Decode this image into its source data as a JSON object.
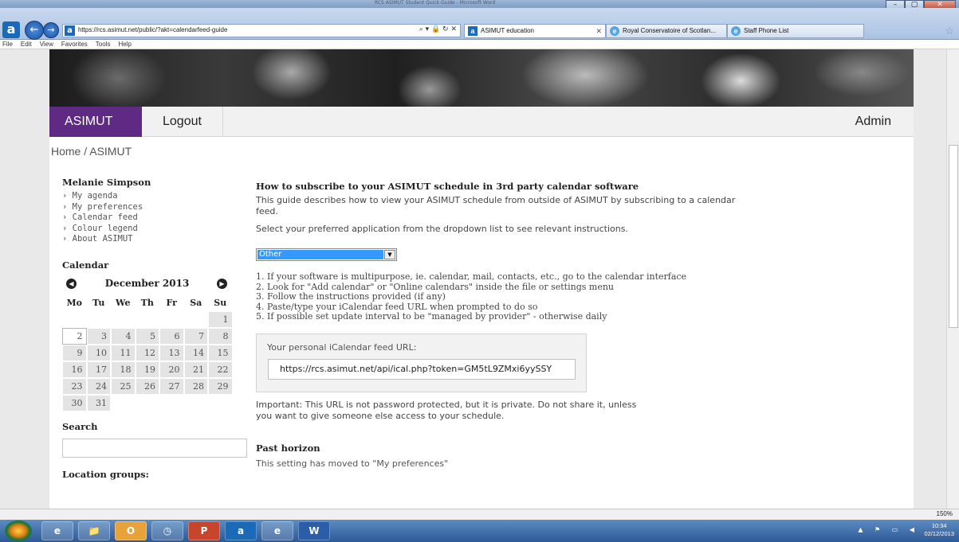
{
  "browser": {
    "window_title": "RCS ASIMUT Student Quick Guide - Microsoft Word",
    "address_url": "https://rcs.asimut.net/public/?akt=calendarfeed-guide",
    "address_controls": "⌕ ▾ 🔒 ↻ ✕",
    "tabs": [
      {
        "label": "ASIMUT education",
        "active": true
      },
      {
        "label": "Royal Conservatoire of Scotlan...",
        "active": false
      },
      {
        "label": "Staff Phone List",
        "active": false
      }
    ],
    "menu": [
      "File",
      "Edit",
      "View",
      "Favorites",
      "Tools",
      "Help"
    ],
    "zoom": "150%"
  },
  "nav": {
    "asimut": "ASIMUT",
    "logout": "Logout",
    "admin": "Admin"
  },
  "breadcrumb": "Home / ASIMUT",
  "sidebar": {
    "user_name": "Melanie Simpson",
    "links": [
      "› My agenda",
      "› My preferences",
      "› Calendar feed",
      "› Colour legend",
      "› About ASIMUT"
    ],
    "calendar_title": "Calendar",
    "calendar_month": "December 2013",
    "weekdays": [
      "Mo",
      "Tu",
      "We",
      "Th",
      "Fr",
      "Sa",
      "Su"
    ],
    "days": [
      "",
      "",
      "",
      "",
      "",
      "",
      "1",
      "2",
      "3",
      "4",
      "5",
      "6",
      "7",
      "8",
      "9",
      "10",
      "11",
      "12",
      "13",
      "14",
      "15",
      "16",
      "17",
      "18",
      "19",
      "20",
      "21",
      "22",
      "23",
      "24",
      "25",
      "26",
      "27",
      "28",
      "29",
      "30",
      "31"
    ],
    "today": "2",
    "search_title": "Search",
    "location_title": "Location groups:"
  },
  "main": {
    "heading": "How to subscribe to your ASIMUT schedule in 3rd party calendar software",
    "intro": "This guide describes how to view your ASIMUT schedule from outside of ASIMUT by subscribing to a calendar feed.",
    "select_prompt": "Select your preferred application from the dropdown list to see relevant instructions.",
    "dropdown_value": "Other",
    "steps": [
      "1.  If your software is multipurpose, ie. calendar, mail, contacts, etc., go to the calendar interface",
      "2.  Look for \"Add calendar\" or \"Online calendars\" inside the file or settings menu",
      "3.  Follow the instructions provided (if any)",
      "4.  Paste/type your iCalendar feed URL when prompted to do so",
      "5.  If possible set update interval to be \"managed by provider\" - otherwise daily"
    ],
    "feed_label": "Your personal iCalendar feed URL:",
    "feed_url": "https://rcs.asimut.net/api/ical.php?token=GM5tL9ZMxi6yySSY",
    "important": "Important: This URL is not password protected, but it is private. Do not share it, unless you want to give someone else access to your schedule.",
    "past_title": "Past horizon",
    "past_text": "This setting has moved to \"My preferences\""
  },
  "taskbar": {
    "apps": [
      "e",
      "📁",
      "O",
      "◷",
      "P",
      "a",
      "e",
      "W"
    ],
    "time": "10:34",
    "date": "02/12/2013"
  }
}
